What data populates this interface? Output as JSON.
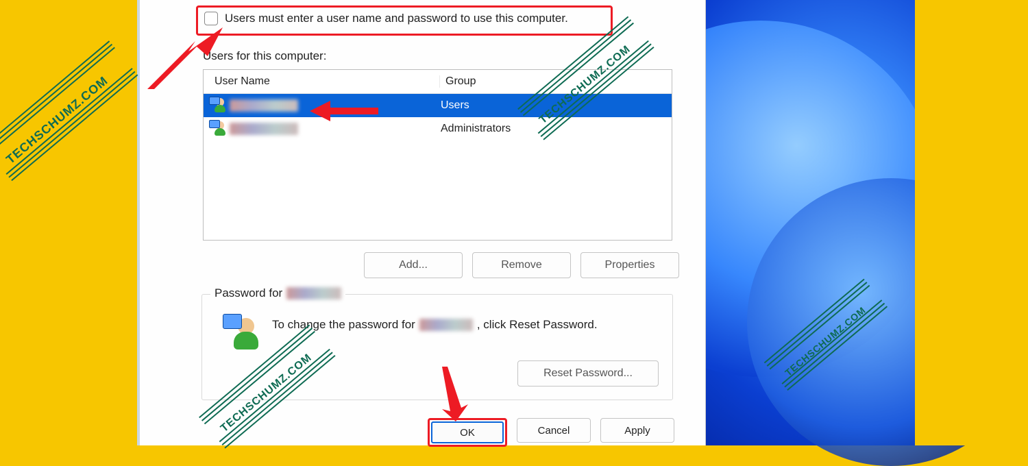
{
  "checkbox_label": "Users must enter a user name and password to use this computer.",
  "users_for_label": "Users for this computer:",
  "list": {
    "columns": {
      "c1": "User Name",
      "c2": "Group"
    },
    "rows": [
      {
        "group": "Users",
        "selected": true
      },
      {
        "group": "Administrators",
        "selected": false
      }
    ]
  },
  "buttons": {
    "add": "Add...",
    "remove": "Remove",
    "properties": "Properties"
  },
  "password_group": {
    "legend": "Password for",
    "text_a": "To change the password for",
    "text_b": ", click Reset Password.",
    "reset_btn": "Reset Password..."
  },
  "footer": {
    "ok": "OK",
    "cancel": "Cancel",
    "apply": "Apply"
  },
  "watermark_text": "TECHSCHUMZ.COM"
}
